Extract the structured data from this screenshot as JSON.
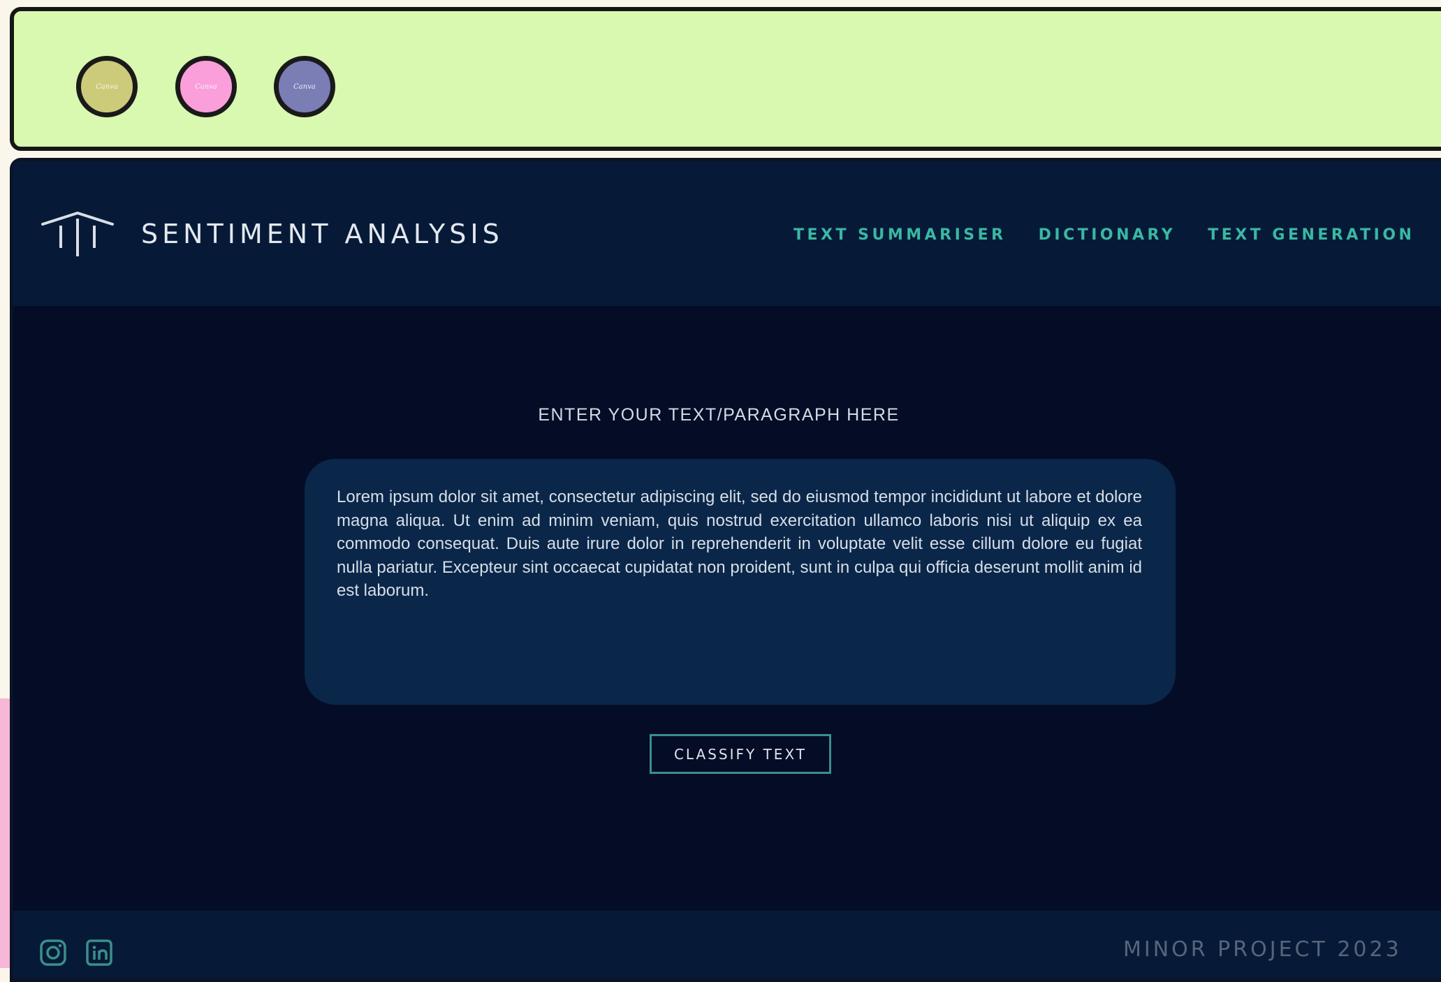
{
  "titlebar": {
    "dots": [
      {
        "label": "Canva",
        "color": "#cccb7a"
      },
      {
        "label": "Canva",
        "color": "#fa9fd9"
      },
      {
        "label": "Canva",
        "color": "#7b7db5"
      }
    ]
  },
  "header": {
    "logo_icon": "pillars-logo-icon",
    "brand": "SENTIMENT ANALYSIS",
    "nav": [
      "TEXT SUMMARISER",
      "DICTIONARY",
      "TEXT GENERATION"
    ]
  },
  "main": {
    "prompt": "ENTER YOUR TEXT/PARAGRAPH HERE",
    "input_value": "Lorem ipsum dolor sit amet, consectetur adipiscing elit, sed do eiusmod tempor incididunt ut labore et dolore magna aliqua. Ut enim ad minim veniam, quis nostrud exercitation ullamco laboris nisi ut aliquip ex ea commodo consequat. Duis aute irure dolor in reprehenderit in voluptate velit esse cillum dolore eu fugiat nulla pariatur. Excepteur sint occaecat cupidatat non proident, sunt in culpa qui officia deserunt mollit anim id est laborum.",
    "button": "CLASSIFY TEXT"
  },
  "footer": {
    "icons": [
      "instagram-icon",
      "linkedin-icon"
    ],
    "text": "MINOR PROJECT 2023"
  },
  "colors": {
    "titlebar_bg": "#d9f8b0",
    "header_bg": "#061a38",
    "body_bg": "#050c26",
    "textbox_bg": "#0a2749",
    "nav_accent": "#3ab8a3"
  }
}
